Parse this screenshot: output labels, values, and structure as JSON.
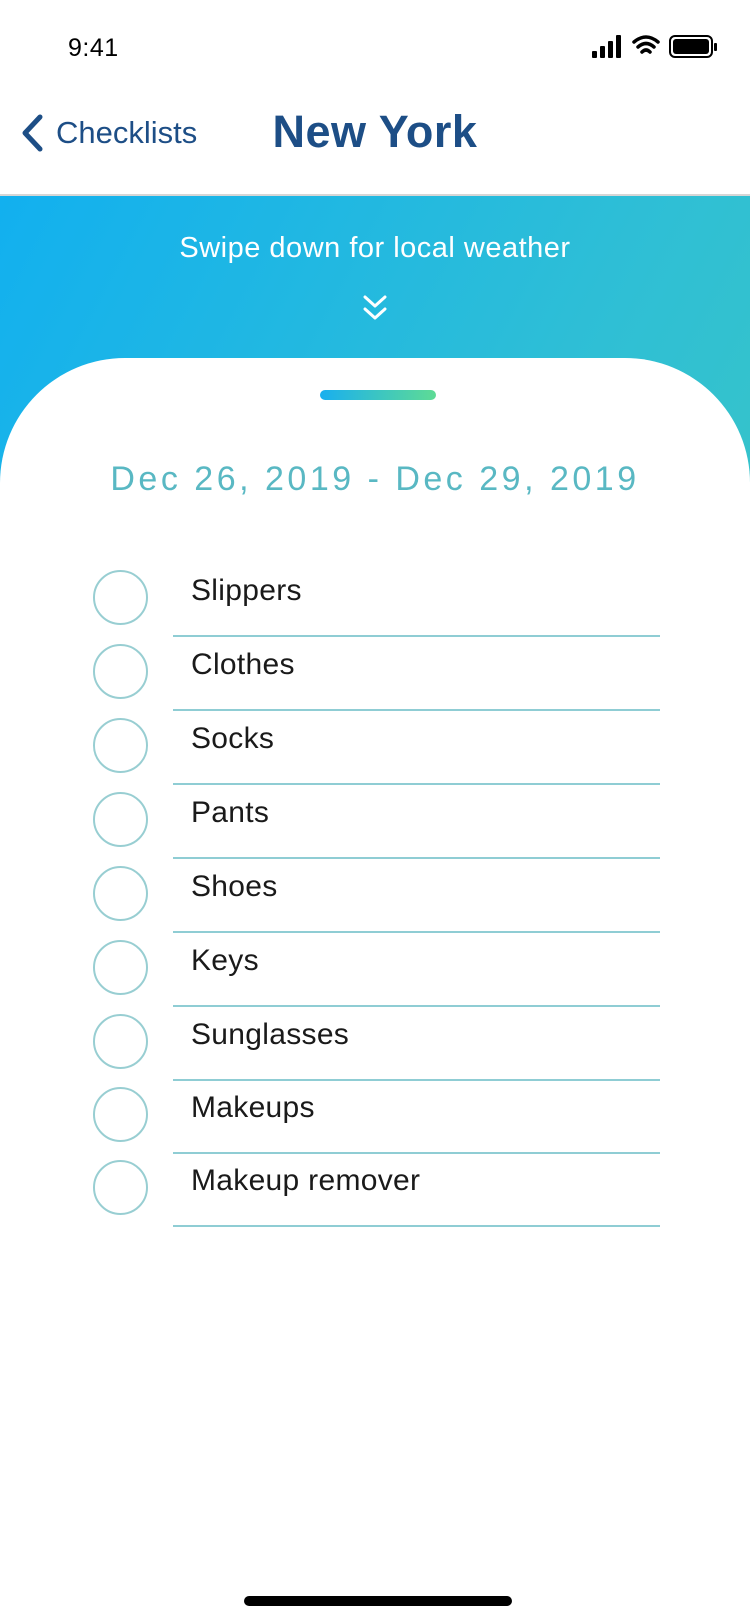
{
  "status_bar": {
    "time": "9:41",
    "icons": [
      "signal-icon",
      "wifi-icon",
      "battery-icon"
    ]
  },
  "nav": {
    "back_label": "Checklists",
    "back_icon": "chevron-left-icon",
    "title": "New York"
  },
  "banner": {
    "hint": "Swipe down for local weather",
    "icon": "double-chevron-down-icon"
  },
  "checklist": {
    "date_range": "Dec 26, 2019 - Dec 29, 2019",
    "items": [
      {
        "label": "Slippers",
        "checked": false
      },
      {
        "label": "Clothes",
        "checked": false
      },
      {
        "label": "Socks",
        "checked": false
      },
      {
        "label": "Pants",
        "checked": false
      },
      {
        "label": "Shoes",
        "checked": false
      },
      {
        "label": "Keys",
        "checked": false
      },
      {
        "label": "Sunglasses",
        "checked": false
      },
      {
        "label": "Makeups",
        "checked": false
      },
      {
        "label": "Makeup remover",
        "checked": false
      }
    ]
  },
  "colors": {
    "brand_navy": "#1d4e86",
    "gradient_start": "#12b0ef",
    "gradient_end": "#45cdb0",
    "date_teal": "#59b8c3",
    "divider_teal": "#8fcdd4"
  }
}
